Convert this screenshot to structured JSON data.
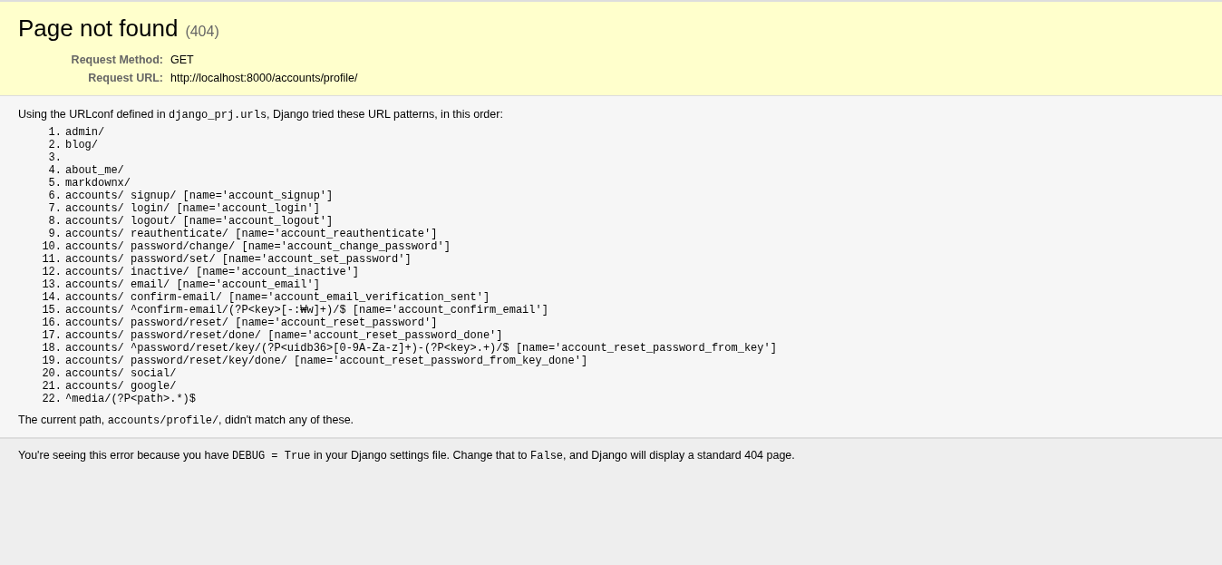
{
  "header": {
    "title": "Page not found",
    "status": "(404)",
    "info": [
      {
        "label": "Request Method:",
        "value": "GET"
      },
      {
        "label": "Request URL:",
        "value": "http://localhost:8000/accounts/profile/"
      }
    ]
  },
  "intro": [
    {
      "kind": "text",
      "text": "Using the URLconf defined in "
    },
    {
      "kind": "code",
      "text": "django_prj.urls"
    },
    {
      "kind": "text",
      "text": ", Django tried these URL patterns, in this order:"
    }
  ],
  "patterns": [
    {
      "number": "1.",
      "pattern": "admin/"
    },
    {
      "number": "2.",
      "pattern": "blog/"
    },
    {
      "number": "3."
    },
    {
      "number": "4.",
      "pattern": "about_me/"
    },
    {
      "number": "5.",
      "pattern": "markdownx/"
    },
    {
      "number": "6.",
      "pattern": "accounts/ signup/ [name='account_signup']"
    },
    {
      "number": "7.",
      "pattern": "accounts/ login/ [name='account_login']"
    },
    {
      "number": "8.",
      "pattern": "accounts/ logout/ [name='account_logout']"
    },
    {
      "number": "9.",
      "pattern": "accounts/ reauthenticate/ [name='account_reauthenticate']"
    },
    {
      "number": "10.",
      "pattern": "accounts/ password/change/ [name='account_change_password']"
    },
    {
      "number": "11.",
      "pattern": "accounts/ password/set/ [name='account_set_password']"
    },
    {
      "number": "12.",
      "pattern": "accounts/ inactive/ [name='account_inactive']"
    },
    {
      "number": "13.",
      "pattern": "accounts/ email/ [name='account_email']"
    },
    {
      "number": "14.",
      "pattern": "accounts/ confirm-email/ [name='account_email_verification_sent']"
    },
    {
      "number": "15.",
      "pattern": "accounts/ ^confirm-email/(?P<key>[-:₩w]+)/$ [name='account_confirm_email']"
    },
    {
      "number": "16.",
      "pattern": "accounts/ password/reset/ [name='account_reset_password']"
    },
    {
      "number": "17.",
      "pattern": "accounts/ password/reset/done/ [name='account_reset_password_done']"
    },
    {
      "number": "18.",
      "pattern": "accounts/ ^password/reset/key/(?P<uidb36>[0-9A-Za-z]+)-(?P<key>.+)/$ [name='account_reset_password_from_key']"
    },
    {
      "number": "19.",
      "pattern": "accounts/ password/reset/key/done/ [name='account_reset_password_from_key_done']"
    },
    {
      "number": "20.",
      "pattern": "accounts/ social/"
    },
    {
      "number": "21.",
      "pattern": "accounts/ google/"
    },
    {
      "number": "22.",
      "pattern": "^media/(?P<path>.*)$"
    }
  ],
  "current_path": [
    {
      "kind": "text",
      "text": "The current path, "
    },
    {
      "kind": "code",
      "text": "accounts/profile/"
    },
    {
      "kind": "text",
      "text": ", didn't match any of these."
    }
  ],
  "explanation": [
    {
      "kind": "text",
      "text": "You're seeing this error because you have "
    },
    {
      "kind": "code",
      "text": "DEBUG = True"
    },
    {
      "kind": "text",
      "text": " in your Django settings file. Change that to "
    },
    {
      "kind": "code",
      "text": "False"
    },
    {
      "kind": "text",
      "text": ", and Django will display a standard 404 page."
    }
  ]
}
